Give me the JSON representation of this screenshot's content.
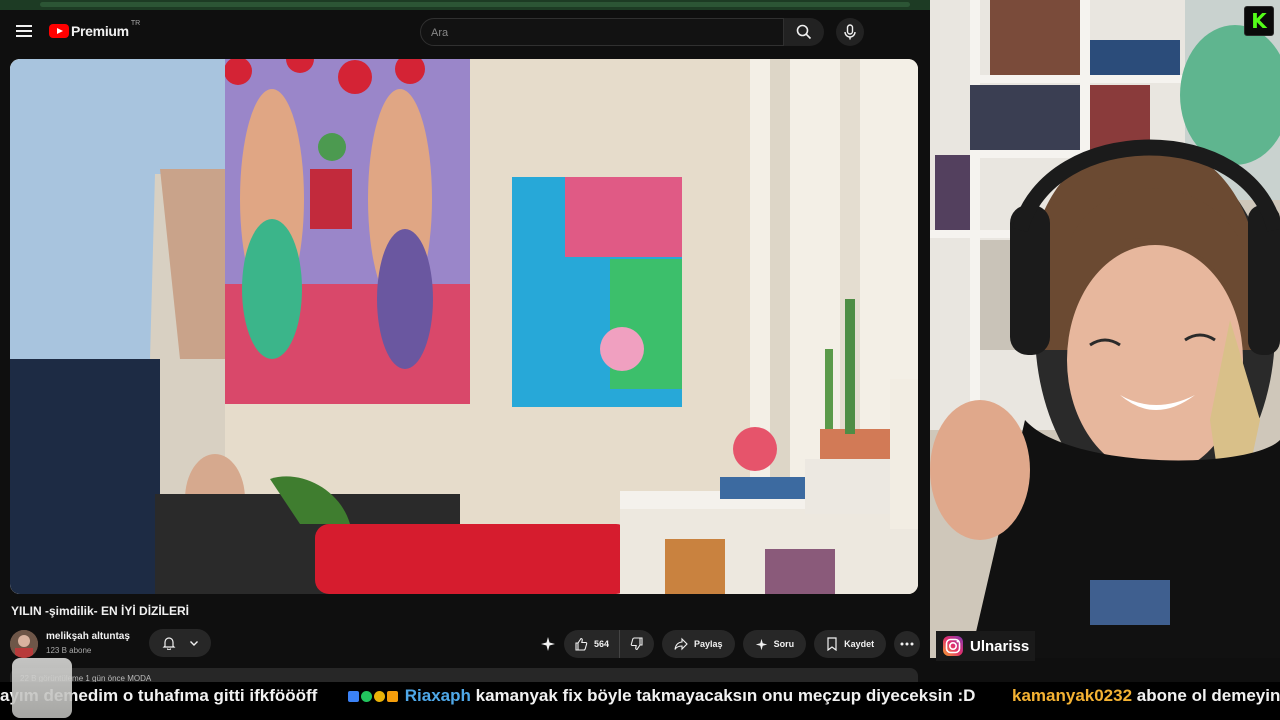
{
  "masthead": {
    "logo_text": "Premium",
    "region": "TR",
    "search_placeholder": "Ara"
  },
  "video": {
    "title": "YILIN -şimdilik- EN İYİ DİZİLERİ",
    "channel_name": "melikşah altuntaş",
    "subscribers": "123 B abone",
    "likes": "564",
    "share_label": "Paylaş",
    "ask_label": "Soru",
    "save_label": "Kaydet",
    "description_meta": "22 B görüntüleme  1 gün önce  MODA"
  },
  "stream": {
    "instagram_handle": "Ulnariss",
    "platform_logo": "K"
  },
  "chat_ticker": [
    {
      "user": "",
      "message": "ayım demedim o tuhafıma gitti ifkföööff"
    },
    {
      "user": "Riaxaph",
      "message": "kamanyak fix böyle takmayacaksın onu meçzup diyeceksin :D"
    },
    {
      "user": "kamanyak0232",
      "message": "abone ol demeyin"
    }
  ],
  "colors": {
    "yt_red": "#ff0000",
    "kick_green": "#53fc18",
    "user1": "#4fa8e8",
    "user2": "#f4b233"
  }
}
